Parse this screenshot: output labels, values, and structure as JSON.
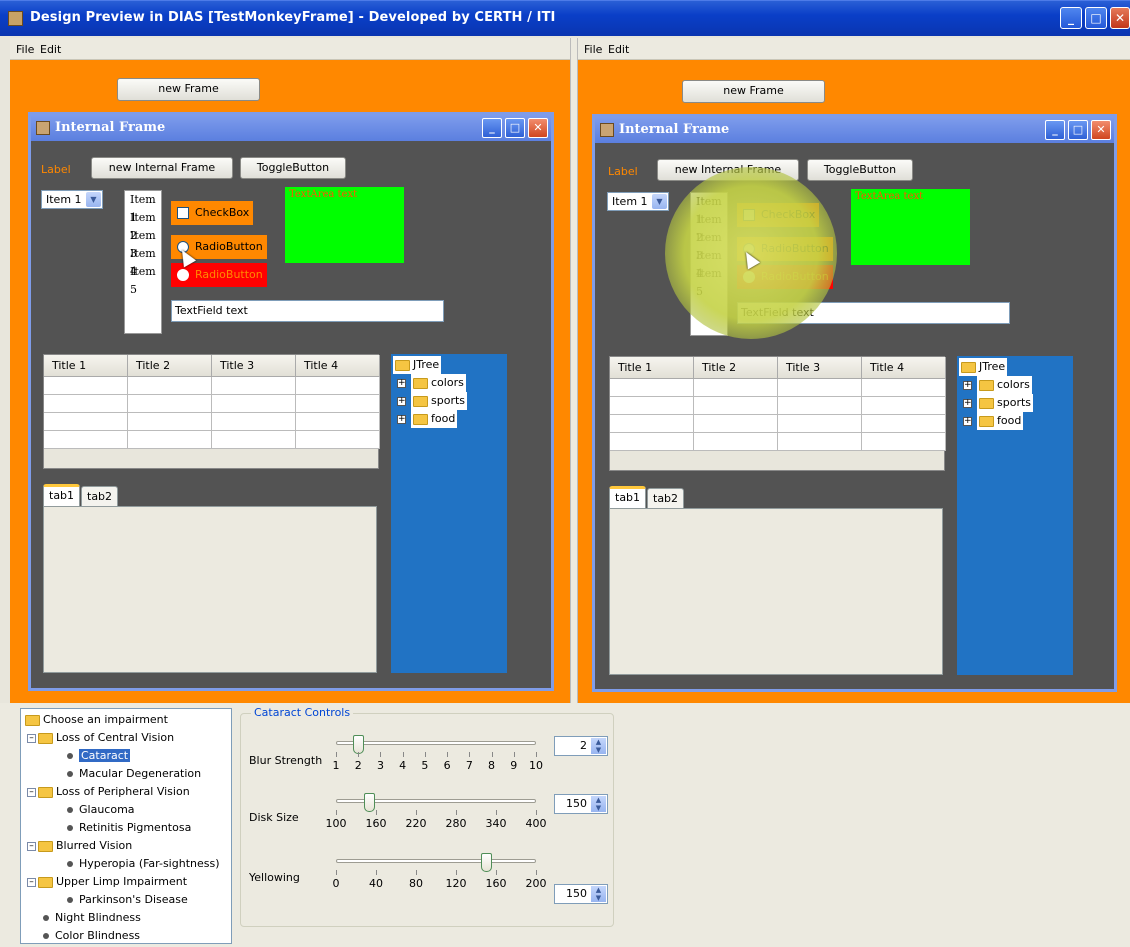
{
  "window": {
    "title": "Design Preview in DIAS [TestMonkeyFrame] - Developed by CERTH / ITI"
  },
  "menu": {
    "file": "File",
    "edit": "Edit"
  },
  "pane": {
    "new_frame": "new Frame",
    "internal_frame_title": "Internal Frame",
    "label": "Label",
    "new_internal_frame": "new Internal Frame",
    "toggle_button": "ToggleButton",
    "combo_value": "Item 1",
    "list_items": [
      "Item 1",
      "Item 2",
      "Item 3",
      "Item 4",
      "Item 5"
    ],
    "checkbox": "CheckBox",
    "radio1": "RadioButton",
    "radio2": "RadioButton",
    "textarea": "TextArea text",
    "textfield": "TextField text",
    "table_headers": [
      "Title 1",
      "Title 2",
      "Title 3",
      "Title 4"
    ],
    "tree_root": "JTree",
    "tree_children": [
      "colors",
      "sports",
      "food"
    ],
    "tabs": [
      "tab1",
      "tab2"
    ]
  },
  "colors": {
    "background": "#ff8800",
    "frame_body": "#535353",
    "tree_bg": "#2173c4",
    "textarea": "#00ff00",
    "highlight": "#d6de60"
  },
  "impairments": {
    "root": "Choose an impairment",
    "groups": [
      {
        "label": "Loss of Central Vision",
        "items": [
          "Cataract",
          "Macular Degeneration"
        ]
      },
      {
        "label": "Loss of Peripheral Vision",
        "items": [
          "Glaucoma",
          "Retinitis Pigmentosa"
        ]
      },
      {
        "label": "Blurred Vision",
        "items": [
          "Hyperopia (Far-sightness)"
        ]
      },
      {
        "label": "Upper Limp Impairment",
        "items": [
          "Parkinson's Disease"
        ]
      }
    ],
    "leaves": [
      "Night Blindness",
      "Color Blindness"
    ],
    "selected": "Cataract"
  },
  "controls": {
    "title": "Cataract Controls",
    "blur": {
      "label": "Blur Strength",
      "value": "2",
      "ticks": [
        "1",
        "2",
        "3",
        "4",
        "5",
        "6",
        "7",
        "8",
        "9",
        "10"
      ],
      "min": 1,
      "max": 10
    },
    "disk": {
      "label": "Disk Size",
      "value": "150",
      "ticks": [
        "100",
        "160",
        "220",
        "280",
        "340",
        "400"
      ],
      "min": 100,
      "max": 400
    },
    "yellow": {
      "label": "Yellowing",
      "value": "150",
      "ticks": [
        "0",
        "40",
        "80",
        "120",
        "160",
        "200"
      ],
      "min": 0,
      "max": 200
    }
  }
}
